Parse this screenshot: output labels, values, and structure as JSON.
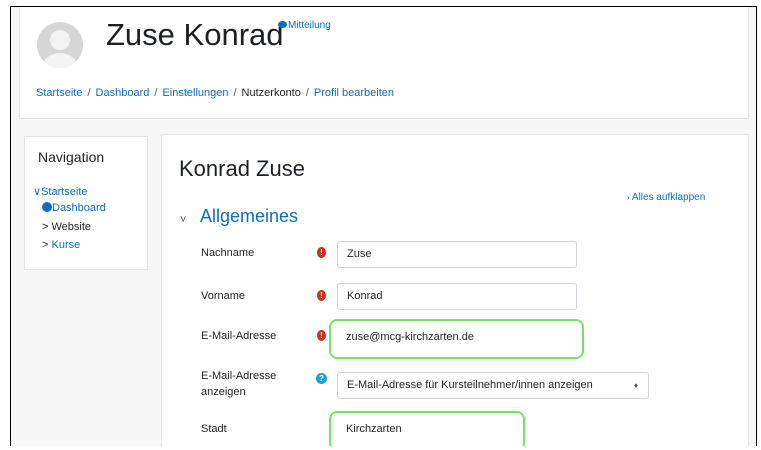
{
  "header": {
    "user_name": "Zuse Konrad",
    "message_link": "Mitteilung",
    "breadcrumb": [
      "Startseite",
      "Dashboard",
      "Einstellungen",
      "Nutzerkonto",
      "Profil bearbeiten"
    ]
  },
  "navigation": {
    "title": "Navigation",
    "items": [
      {
        "label": "Startseite",
        "prefix": "∨"
      },
      {
        "label": "Dashboard"
      },
      {
        "label": "Website",
        "prefix": ">"
      },
      {
        "label": "Kurse",
        "prefix": ">"
      }
    ]
  },
  "main": {
    "title": "Konrad Zuse",
    "expand_all": "Alles aufklappen",
    "section_title": "Allgemeines",
    "fields": [
      {
        "label": "Nachname",
        "value": "Zuse",
        "icon": "required-icon"
      },
      {
        "label": "Vorname",
        "value": "Konrad",
        "icon": "required-icon"
      },
      {
        "label": "E-Mail-Adresse",
        "value": "zuse@mcg-kirchzarten.de",
        "icon": "required-icon"
      },
      {
        "label_line1": "E-Mail-Adresse",
        "label_line2": "anzeigen",
        "value": "E-Mail-Adresse für Kursteilnehmer/innen anzeigen",
        "icon": "help-icon"
      },
      {
        "label": "Stadt",
        "value": "Kirchzarten"
      }
    ]
  },
  "colors": {
    "link": "#0f6cbf",
    "required": "#ca3120",
    "help": "#1f9fd8",
    "highlight": "#7ae067"
  }
}
